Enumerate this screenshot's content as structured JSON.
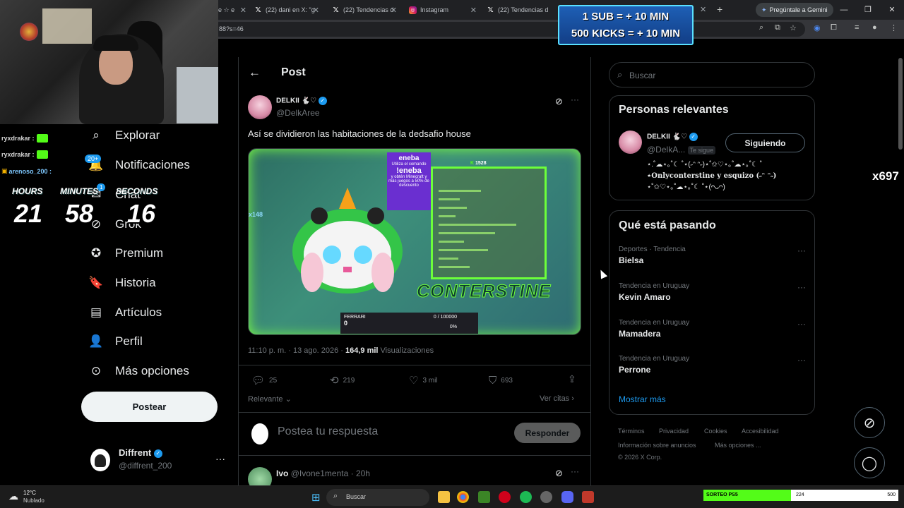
{
  "browser": {
    "tabs": [
      {
        "label": "(22) dani en X: \"g",
        "icon": "x-logo-icon"
      },
      {
        "label": "(22) Tendencias d",
        "icon": "x-logo-icon"
      },
      {
        "label": "Instagram",
        "icon": "instagram-icon"
      },
      {
        "label": "(22) Tendencias d",
        "icon": "x-logo-icon"
      }
    ],
    "first_tab_fragment": "e ☆ e",
    "url_fragment": "88?s=46",
    "gemini_label": "Pregúntale a Gemini"
  },
  "stream": {
    "banner_line1": "1 SUB = + 10 MIN",
    "banner_line2": "500 KICKS = + 10 MIN",
    "chat": [
      {
        "user": "ryxdrakar :"
      },
      {
        "user": "ryxdrakar :"
      },
      {
        "user": "arenoso_200 :"
      }
    ],
    "timer": {
      "hours_label": "HOURS",
      "minutes_label": "MINUTES",
      "seconds_label": "SECONDS",
      "hours": "21",
      "minutes": "58",
      "seconds": "16"
    },
    "kick_counter": "x697"
  },
  "nav": {
    "items": [
      {
        "label": "Explorar",
        "icon": "search-icon"
      },
      {
        "label": "Notificaciones",
        "icon": "bell-icon",
        "badge": "20+"
      },
      {
        "label": "Chat",
        "icon": "chat-icon",
        "badge": "1"
      },
      {
        "label": "Grok",
        "icon": "grok-icon"
      },
      {
        "label": "Premium",
        "icon": "premium-badge-icon"
      },
      {
        "label": "Historia",
        "icon": "bookmark-icon"
      },
      {
        "label": "Artículos",
        "icon": "articles-icon"
      },
      {
        "label": "Perfil",
        "icon": "person-icon"
      },
      {
        "label": "Más opciones",
        "icon": "more-circle-icon"
      }
    ],
    "post_button": "Postear",
    "account": {
      "name": "Diffrent",
      "handle": "@diffrent_200"
    }
  },
  "post": {
    "header": "Post",
    "author_name": "DELKII 🐇♡",
    "author_handle": "@DelkAree",
    "text": "Así se dividieron las habitaciones de la dedsafio house",
    "timestamp": "11:10 p. m. · 13 ago. 2026 · ",
    "views_count": "164,9 mil",
    "views_label": " Visualizaciones",
    "stats": {
      "replies": "25",
      "reposts": "219",
      "likes": "3 mil",
      "bookmarks": "693"
    },
    "sort_label": "Relevante",
    "quotes_label": "Ver citas",
    "reply_placeholder": "Postea tu respuesta",
    "reply_button": "Responder",
    "media": {
      "eneba_title": "eneba",
      "eneba_text1": "Utiliza el comando",
      "eneba_cmd": "!eneba",
      "eneba_text2": "y obtén Minecraft y más juegos a 50% de descuento",
      "kick_count": "1528",
      "streamer_title": "CONTERSTINE",
      "ferrari_label": "FERRARI",
      "ferrari_value": "0",
      "ferrari_goal": "0 / 100000",
      "ferrari_pct": "0%",
      "multiplier": "x148"
    },
    "next_reply": {
      "name": "Ivo",
      "handle": "@Ivone1menta",
      "age": "20h"
    }
  },
  "sidebar": {
    "search_placeholder": "Buscar",
    "people_title": "Personas relevantes",
    "person": {
      "name": "DELKII 🐇♡",
      "handle": "@DelkA...",
      "follows_you": "Te sigue",
      "following_button": "Siguiendo",
      "bio1": "⋆.˚☁︎⋆｡˚☾ ˚⋆(˶ᵔ ᵔ˶)⋆˚✩♡⋆｡˚☁︎⋆｡˚☾ ˚",
      "bio2": "⋆Onlyconterstine y esquizo (˶ᵔ ᵔ˶)",
      "bio3": "⋆˚✩♡⋆｡˚☁︎⋆｡˚☾ ˚⋆(ᴖᴗᴖ)"
    },
    "trends_title": "Qué está pasando",
    "trends": [
      {
        "meta": "Deportes · Tendencia",
        "name": "Bielsa"
      },
      {
        "meta": "Tendencia en Uruguay",
        "name": "Kevin Amaro"
      },
      {
        "meta": "Tendencia en Uruguay",
        "name": "Mamadera"
      },
      {
        "meta": "Tendencia en Uruguay",
        "name": "Perrone"
      }
    ],
    "show_more": "Mostrar más",
    "footer": {
      "terms": "Términos",
      "privacy": "Privacidad",
      "cookies": "Cookies",
      "accessibility": "Accesibilidad",
      "ads": "Información sobre anuncios",
      "more": "Más opciones ...",
      "copyright": "© 2026 X Corp."
    }
  },
  "taskbar": {
    "weather_temp": "12°C",
    "weather_desc": "Nublado",
    "search_placeholder": "Buscar",
    "sorteo_label": "SORTEO PS5",
    "sorteo_current": "224",
    "sorteo_goal": "500",
    "sorteo_progress": 0.45
  },
  "colors": {
    "accent": "#1d9bf0",
    "kick_green": "#53fc18",
    "bg": "#000000",
    "text": "#e7e9ea",
    "muted": "#71767b"
  }
}
